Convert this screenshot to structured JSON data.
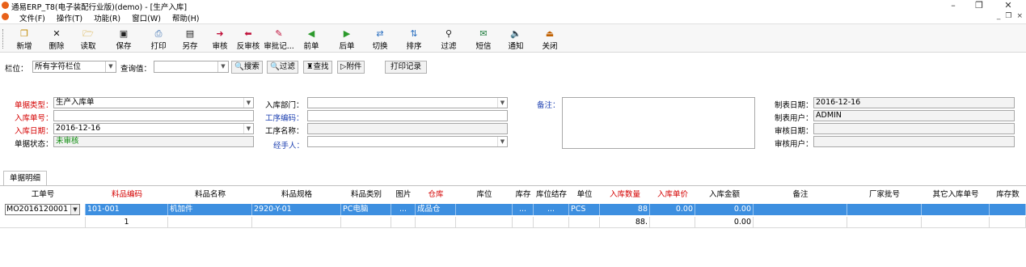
{
  "window": {
    "title": "通易ERP_T8(电子装配行业版)(demo) - [生产入库]",
    "min_glyph": "–",
    "max_glyph": "❐",
    "close_glyph": "✕"
  },
  "menu": {
    "items": [
      "文件(F)",
      "操作(T)",
      "功能(R)",
      "窗口(W)",
      "帮助(H)"
    ],
    "child_controls": [
      "_",
      "❐",
      "×"
    ]
  },
  "toolbar": {
    "buttons": [
      {
        "label": "新增",
        "icon": "new-doc-icon",
        "glyph": "❐"
      },
      {
        "label": "删除",
        "icon": "delete-icon",
        "glyph": "✕"
      },
      {
        "label": "读取",
        "icon": "open-folder-icon",
        "glyph": "🗁"
      },
      {
        "label": "保存",
        "icon": "save-icon",
        "glyph": "▣"
      },
      {
        "label": "打印",
        "icon": "print-icon",
        "glyph": "⎙"
      },
      {
        "label": "另存",
        "icon": "save-as-icon",
        "glyph": "▤"
      },
      {
        "label": "审核",
        "icon": "approve-arrow-icon",
        "glyph": "➜"
      },
      {
        "label": "反审核",
        "icon": "unapprove-arrow-icon",
        "glyph": "⬅"
      },
      {
        "label": "审批记...",
        "icon": "approval-log-icon",
        "glyph": "✎"
      },
      {
        "label": "前单",
        "icon": "prev-icon",
        "glyph": "◀"
      },
      {
        "label": "后单",
        "icon": "next-icon",
        "glyph": "▶"
      },
      {
        "label": "切换",
        "icon": "switch-icon",
        "glyph": "⇄"
      },
      {
        "label": "排序",
        "icon": "sort-icon",
        "glyph": "⇅"
      },
      {
        "label": "过滤",
        "icon": "filter-icon",
        "glyph": "⚲"
      },
      {
        "label": "短信",
        "icon": "sms-icon",
        "glyph": "✉"
      },
      {
        "label": "通知",
        "icon": "speaker-icon",
        "glyph": "🔈"
      },
      {
        "label": "关闭",
        "icon": "exit-door-icon",
        "glyph": "⏏"
      }
    ]
  },
  "search": {
    "column_label": "栏位：",
    "column_value": "所有字符栏位",
    "query_label": "查询值：",
    "query_value": "",
    "buttons": [
      {
        "label": "搜索",
        "glyph": "🔍"
      },
      {
        "label": "过滤",
        "glyph": "🔍"
      },
      {
        "label": "查找",
        "glyph": "♜"
      },
      {
        "label": "附件",
        "glyph": "▷"
      },
      {
        "label": "打印记录",
        "glyph": ""
      }
    ]
  },
  "form": {
    "doc_type_label": "单据类型：",
    "doc_type_value": "生产入库单",
    "doc_no_label": "入库单号：",
    "doc_no_value": "",
    "date_label": "入库日期：",
    "date_value": "2016-12-16",
    "status_label": "单据状态：",
    "status_value": "未审核",
    "dept_label": "入库部门：",
    "dept_value": "",
    "process_code_label": "工序编码：",
    "process_code_value": "",
    "process_name_label": "工序名称：",
    "process_name_value": "",
    "handler_label": "经手人：",
    "handler_value": "",
    "memo_label": "备注：",
    "memo_value": "",
    "created_date_label": "制表日期：",
    "created_date_value": "2016-12-16",
    "creator_label": "制表用户：",
    "creator_value": "ADMIN",
    "audit_date_label": "审核日期：",
    "audit_date_value": "",
    "auditor_label": "审核用户：",
    "auditor_value": ""
  },
  "tab": {
    "label": "单据明细"
  },
  "grid": {
    "columns": [
      "工单号",
      "料品编码",
      "料品名称",
      "料品规格",
      "料品类别",
      "图片",
      "仓库",
      "库位",
      "库存",
      "库位结存",
      "单位",
      "入库数量",
      "入库单价",
      "入库金额",
      "备注",
      "厂家批号",
      "其它入库单号",
      "库存数"
    ],
    "rows": [
      {
        "wo": "MO2016120001",
        "code": "101-001",
        "name": "机加件",
        "spec": "2920-Y-01",
        "category": "PC电脑",
        "image": "...",
        "warehouse": "成品仓",
        "location": "",
        "stock": "...",
        "loc_balance": "...",
        "unit": "PCS",
        "qty": "88",
        "price": "0.00",
        "amount": "0.00",
        "remark": "",
        "batch": "",
        "other_no": "",
        "stock_qty": ""
      }
    ],
    "totals": {
      "count": "1",
      "qty": "88.",
      "amount": "0.00"
    }
  },
  "colors": {
    "required_label": "#d40000",
    "link_label": "#1c3fb0",
    "status_ok": "#0a8a0a",
    "selected_row": "#3d8fe0"
  }
}
